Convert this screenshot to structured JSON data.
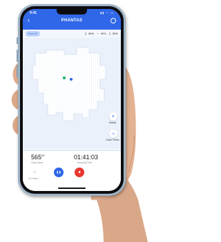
{
  "status_bar": {
    "time": "9:41",
    "icons": "▮▮ ◠ ▭"
  },
  "app_bar": {
    "title": "PHANTAS",
    "back_glyph": "‹"
  },
  "info_row": {
    "map_chip": "Floor 1F",
    "consumables": [
      "60%",
      "40%",
      "50%"
    ]
  },
  "side_actions": [
    {
      "glyph": "➤",
      "label": "Sweep"
    },
    {
      "glyph": "1X",
      "label": "Clean Times"
    }
  ],
  "stats": {
    "area": {
      "value": "565",
      "unit": "m²",
      "label": "Clean Area"
    },
    "time": {
      "value": "01:41:03",
      "label": "Cleaning Time"
    }
  },
  "controls": {
    "dock_label": "Go home",
    "pause_glyph": "❚❚",
    "stop_glyph": "■"
  },
  "colors": {
    "primary": "#2f67e8",
    "stop": "#e8382f",
    "map_fill": "#ffffff",
    "background": "#eef4fc"
  }
}
